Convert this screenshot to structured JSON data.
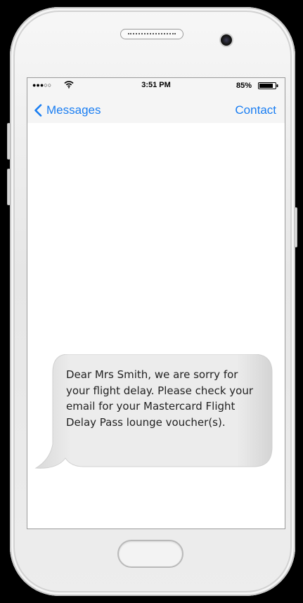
{
  "status_bar": {
    "signal": "●●●○○",
    "time": "3:51 PM",
    "battery": "85%"
  },
  "nav": {
    "back_label": "Messages",
    "contact_label": "Contact"
  },
  "message": {
    "text": "Dear Mrs Smith, we are sorry for your flight delay. Please check your email for your Mastercard Flight Delay Pass lounge voucher(s)."
  },
  "colors": {
    "ios_blue": "#1a7ef2",
    "bubble_gray": "#e9e9eb",
    "phone_white": "#f2f2f2"
  },
  "icons": {
    "back": "chevron-left-icon",
    "wifi": "wifi-icon",
    "battery": "battery-icon"
  }
}
